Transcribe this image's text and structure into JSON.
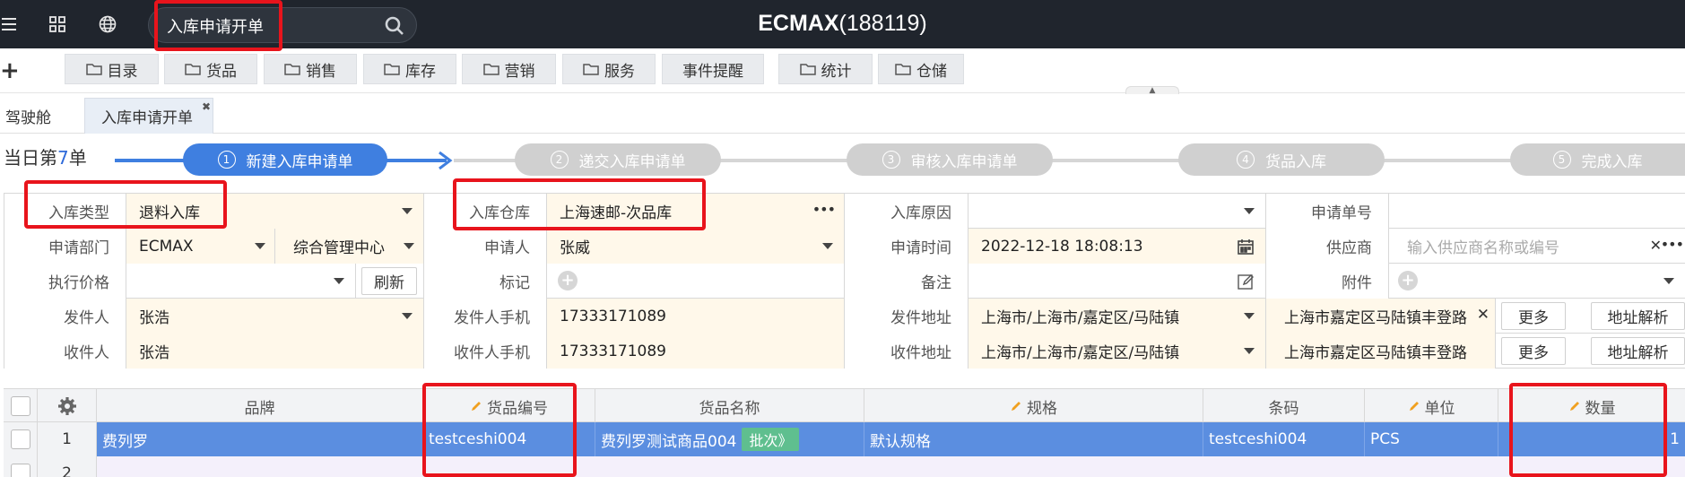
{
  "header": {
    "search_value": "入库申请开单",
    "app_title": "ECMAX",
    "app_subtitle": "(188119)"
  },
  "nav": {
    "items": [
      {
        "label": "目录",
        "icon": "folder-icon"
      },
      {
        "label": "货品",
        "icon": "folder-icon"
      },
      {
        "label": "销售",
        "icon": "folder-icon"
      },
      {
        "label": "库存",
        "icon": "folder-icon"
      },
      {
        "label": "营销",
        "icon": "folder-icon"
      },
      {
        "label": "服务",
        "icon": "folder-icon"
      },
      {
        "label": "事件提醒",
        "icon": ""
      },
      {
        "label": "统计",
        "icon": "folder-icon"
      },
      {
        "label": "仓储",
        "icon": "folder-icon"
      }
    ]
  },
  "tabs": [
    {
      "label": "驾驶舱"
    },
    {
      "label": "入库申请开单",
      "active": true
    }
  ],
  "progress": {
    "today_prefix": "当日第",
    "today_count": "7",
    "today_suffix": "单",
    "steps": [
      {
        "num": "1",
        "label": "新建入库申请单",
        "active": true
      },
      {
        "num": "2",
        "label": "递交入库申请单"
      },
      {
        "num": "3",
        "label": "审核入库申请单"
      },
      {
        "num": "4",
        "label": "货品入库"
      },
      {
        "num": "5",
        "label": "完成入库"
      }
    ],
    "active_color": "#3f7fe0",
    "inactive_color": "#d0d0d0"
  },
  "form": {
    "inbound_type_label": "入库类型",
    "inbound_type_value": "退料入库",
    "warehouse_label": "入库仓库",
    "warehouse_value": "上海速邮-次品库",
    "reason_label": "入库原因",
    "reason_value": "",
    "apply_no_label": "申请单号",
    "apply_no_value": "",
    "dept_label": "申请部门",
    "dept_value": "ECMAX",
    "dept_center_value": "综合管理中心",
    "applicant_label": "申请人",
    "applicant_value": "张威",
    "apply_time_label": "申请时间",
    "apply_time_value": "2022-12-18 18:08:13",
    "supplier_label": "供应商",
    "supplier_placeholder": "输入供应商名称或编号",
    "exec_price_label": "执行价格",
    "refresh_label": "刷新",
    "mark_label": "标记",
    "remark_label": "备注",
    "attachment_label": "附件",
    "sender_label": "发件人",
    "sender_value": "张浩",
    "sender_phone_label": "发件人手机",
    "sender_phone_value": "17333171089",
    "sender_addr_label": "发件地址",
    "sender_addr_value": "上海市/上海市/嘉定区/马陆镇",
    "sender_addr_detail": "上海市嘉定区马陆镇丰登路",
    "more_label": "更多",
    "parse_label": "地址解析",
    "receiver_label": "收件人",
    "receiver_value": "张浩",
    "receiver_phone_label": "收件人手机",
    "receiver_phone_value": "17333171089",
    "receiver_addr_label": "收件地址",
    "receiver_addr_value": "上海市/上海市/嘉定区/马陆镇",
    "receiver_addr_detail": "上海市嘉定区马陆镇丰登路"
  },
  "grid": {
    "columns": {
      "brand": "品牌",
      "code": "货品编号",
      "name": "货品名称",
      "spec": "规格",
      "barcode": "条码",
      "unit": "单位",
      "qty": "数量"
    },
    "rows": [
      {
        "idx": "1",
        "brand": "费列罗",
        "code": "testceshi004",
        "name": "费列罗测试商品004",
        "batch": "批次》",
        "spec": "默认规格",
        "barcode": "testceshi004",
        "unit": "PCS",
        "qty": "1"
      },
      {
        "idx": "2"
      }
    ]
  }
}
